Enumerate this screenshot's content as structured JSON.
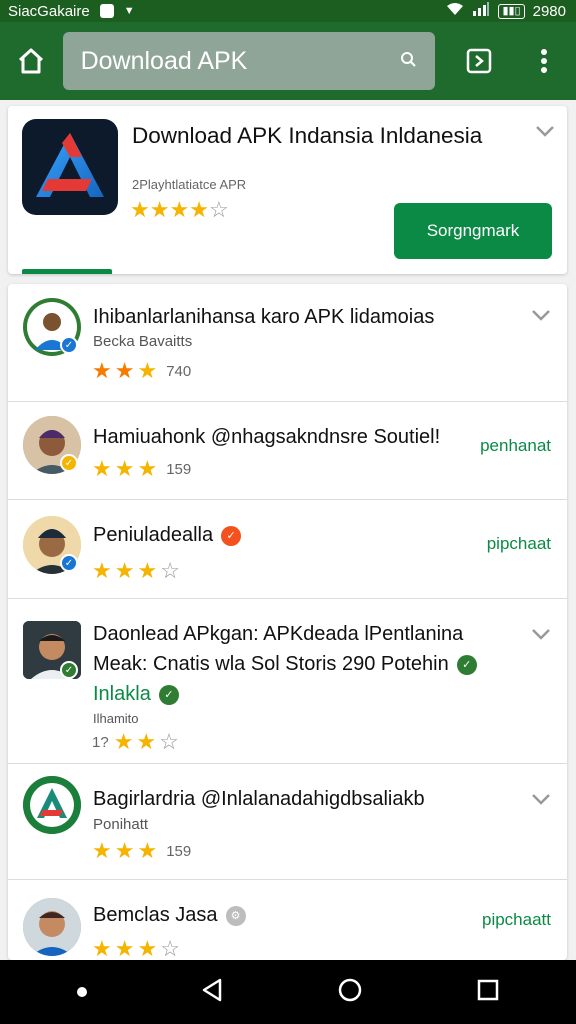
{
  "status_bar": {
    "left_text": "SiacGakaire",
    "time": "2980"
  },
  "app_bar": {
    "search_value": "Download APK"
  },
  "hero": {
    "title": "Download APK Indansia Inldanesia",
    "subtitle": "2Playhtlatiatce APR",
    "rating": 4,
    "install_label": "Sorgngmark",
    "brand_color": "#0b8a45"
  },
  "list": [
    {
      "title": "Ihibanlarlanihansa karo APK lidamoias",
      "subtitle": "Becka Bavaitts",
      "rating": 3,
      "count": "740",
      "action": ""
    },
    {
      "title": "Hamiuahonk @nhagsakndnsre Soutiel!",
      "subtitle": "",
      "rating": 3,
      "count": "159",
      "action": "penhanat"
    },
    {
      "title": "Peniuladealla",
      "subtitle": "",
      "rating": 3,
      "count": "",
      "action": "pipchaat"
    },
    {
      "title": "Daonlead APkgan: APKdeada lPentlanina",
      "title2": "Meak: Cnatis wla Sol Storis 290 Potehin",
      "title3": "Inlakla",
      "subtitle": "Ilhamito",
      "rating": 3,
      "count": "1?",
      "action": ""
    },
    {
      "title": "Bagirlardria @Inlalanadahigdbsaliakb",
      "subtitle": "Ponihatt",
      "rating": 3,
      "count": "159",
      "action": ""
    },
    {
      "title": "Bemclas Jasa",
      "subtitle": "",
      "rating": 3,
      "count": "",
      "action": "pipchaatt"
    }
  ]
}
